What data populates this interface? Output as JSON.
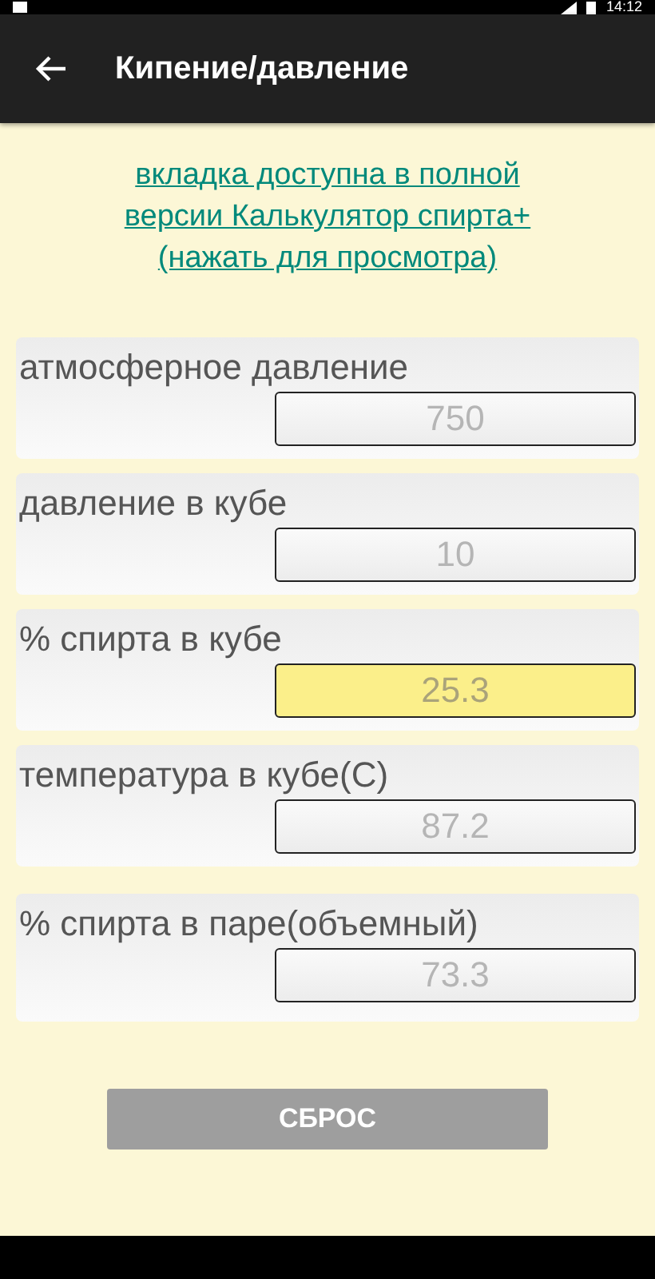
{
  "status_bar": {
    "time": "14:12"
  },
  "app_bar": {
    "title": "Кипение/давление"
  },
  "promo_link": "вкладка доступна в полной версии Калькулятор спирта+ (нажать для просмотра)",
  "fields": [
    {
      "label": "атмосферное давление",
      "value": "750",
      "highlighted": false
    },
    {
      "label": "давление в кубе",
      "value": "10",
      "highlighted": false
    },
    {
      "label": "% спирта в кубе",
      "value": "25.3",
      "highlighted": true
    },
    {
      "label": "температура в кубе(С)",
      "value": "87.2",
      "highlighted": false
    },
    {
      "label": "% спирта в паре(объемный)",
      "value": "73.3",
      "highlighted": false
    }
  ],
  "reset_button": {
    "label": "СБРОС",
    "disabled": true
  }
}
